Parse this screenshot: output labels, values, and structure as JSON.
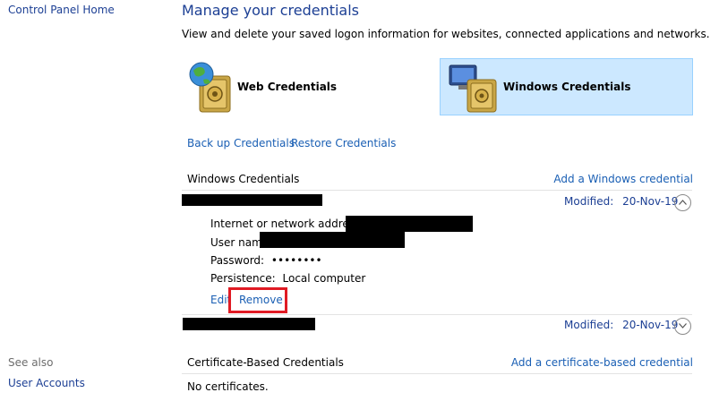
{
  "sidebar": {
    "home": "Control Panel Home",
    "see_also": "See also",
    "user_accounts": "User Accounts"
  },
  "main": {
    "title": "Manage your credentials",
    "description": "View and delete your saved logon information for websites, connected applications and networks.",
    "tiles": [
      {
        "label": "Web Credentials",
        "selected": false,
        "icon": "web-vault-icon"
      },
      {
        "label": "Windows Credentials",
        "selected": true,
        "icon": "windows-vault-icon"
      }
    ],
    "backup_link": "Back up Credentials",
    "restore_link": "Restore Credentials"
  },
  "windows_section": {
    "header": "Windows Credentials",
    "add_link": "Add a Windows credential",
    "entries": [
      {
        "modified_label": "Modified:",
        "modified_date": "20-Nov-19",
        "expanded": true,
        "details": {
          "address_label": "Internet or network address:",
          "username_label": "User name",
          "password_label": "Password:",
          "password_value": "••••••••",
          "persistence_label": "Persistence:",
          "persistence_value": "Local computer"
        },
        "edit_label": "Edit",
        "remove_label": "Remove"
      },
      {
        "modified_label": "Modified:",
        "modified_date": "20-Nov-19",
        "expanded": false
      }
    ]
  },
  "cert_section": {
    "header": "Certificate-Based Credentials",
    "add_link": "Add a certificate-based credential",
    "empty": "No certificates."
  },
  "colors": {
    "link": "#1a5fb4",
    "title": "#1c3f94",
    "selected_tile_bg": "#cce8ff",
    "highlight": "#e01b24"
  }
}
